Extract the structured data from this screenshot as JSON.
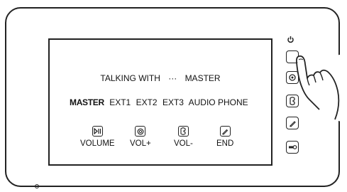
{
  "status": {
    "prefix": "TALKING WITH",
    "separator": "···",
    "target": "MASTER"
  },
  "channels": [
    {
      "label": "MASTER",
      "selected": true
    },
    {
      "label": "EXT1",
      "selected": false
    },
    {
      "label": "EXT2",
      "selected": false
    },
    {
      "label": "EXT3",
      "selected": false
    },
    {
      "label": "AUDIO PHONE",
      "selected": false
    }
  ],
  "functions": [
    {
      "label": "VOLUME",
      "icon": "play-pause-icon"
    },
    {
      "label": "VOL+",
      "icon": "speaker-icon"
    },
    {
      "label": "VOL-",
      "icon": "handset-icon"
    },
    {
      "label": "END",
      "icon": "pen-icon"
    }
  ],
  "side_buttons": [
    {
      "name": "talk-button",
      "icon": "blank",
      "pressed": true
    },
    {
      "name": "monitor-button",
      "icon": "monitor-icon"
    },
    {
      "name": "handset-button",
      "icon": "handset-icon"
    },
    {
      "name": "pen-button",
      "icon": "pen-icon"
    },
    {
      "name": "unlock-button",
      "icon": "key-icon"
    }
  ]
}
